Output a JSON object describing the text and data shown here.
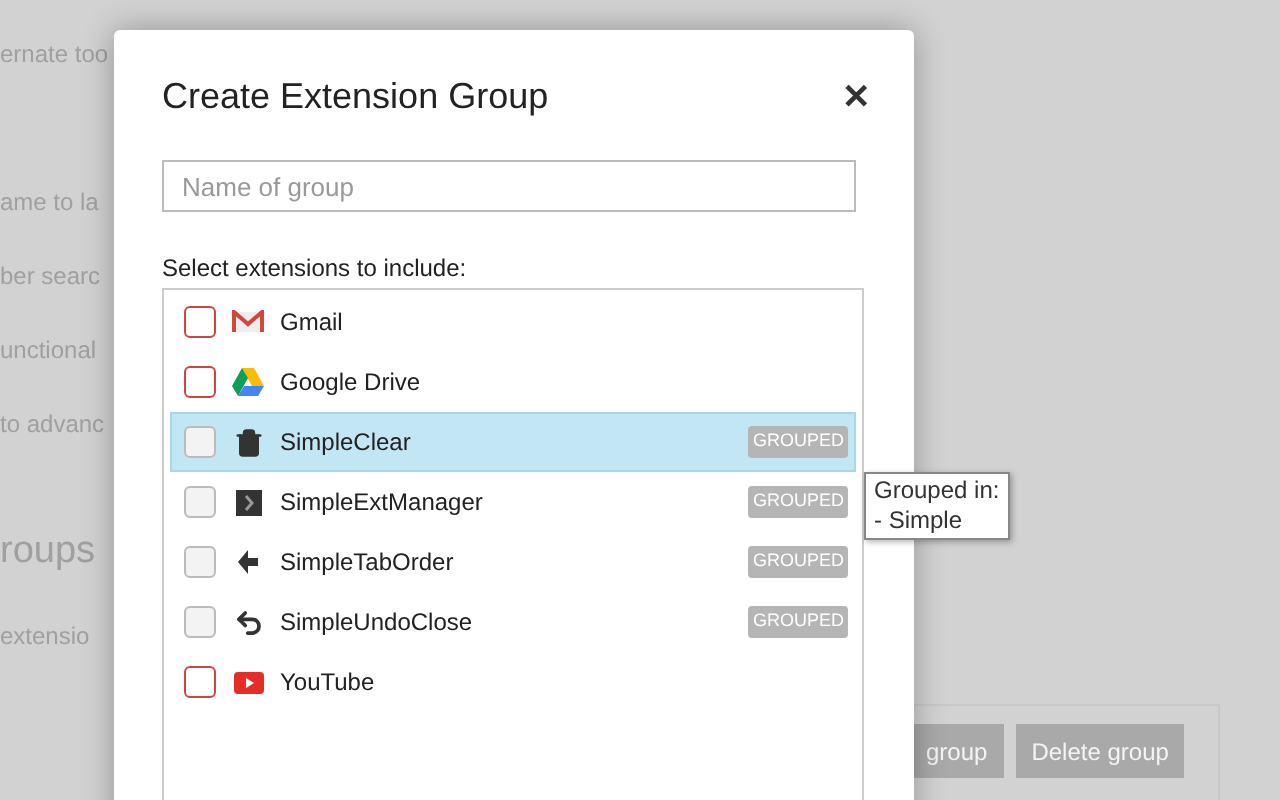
{
  "background": {
    "lines": [
      "ernate too",
      "ame to la",
      "ber searc",
      "unctional",
      "to advanc"
    ],
    "heading": "roups",
    "subtext": "extensio",
    "buttons": [
      "group",
      "Delete group"
    ]
  },
  "dialog": {
    "title": "Create Extension Group",
    "close": "✕",
    "name_field": {
      "placeholder": "Name of group"
    },
    "list_label": "Select extensions to include:",
    "extensions": [
      {
        "name": "Gmail",
        "kind": "mail",
        "checked": false,
        "selected": false
      },
      {
        "name": "Google Drive",
        "kind": "drive",
        "checked": false,
        "selected": false
      },
      {
        "name": "SimpleClear",
        "kind": "trash",
        "checked": false,
        "selected": true,
        "badge": "GROUPED"
      },
      {
        "name": "SimpleExtManager",
        "kind": "manager",
        "checked": false,
        "selected": false,
        "badge": "GROUPED"
      },
      {
        "name": "SimpleTabOrder",
        "kind": "tab",
        "checked": false,
        "selected": false,
        "badge": "GROUPED"
      },
      {
        "name": "SimpleUndoClose",
        "kind": "undo",
        "checked": false,
        "selected": false,
        "badge": "GROUPED"
      },
      {
        "name": "YouTube",
        "kind": "video",
        "checked": false,
        "selected": false
      }
    ]
  },
  "tooltip": {
    "lines": [
      "Grouped in:",
      "- Simple"
    ]
  }
}
